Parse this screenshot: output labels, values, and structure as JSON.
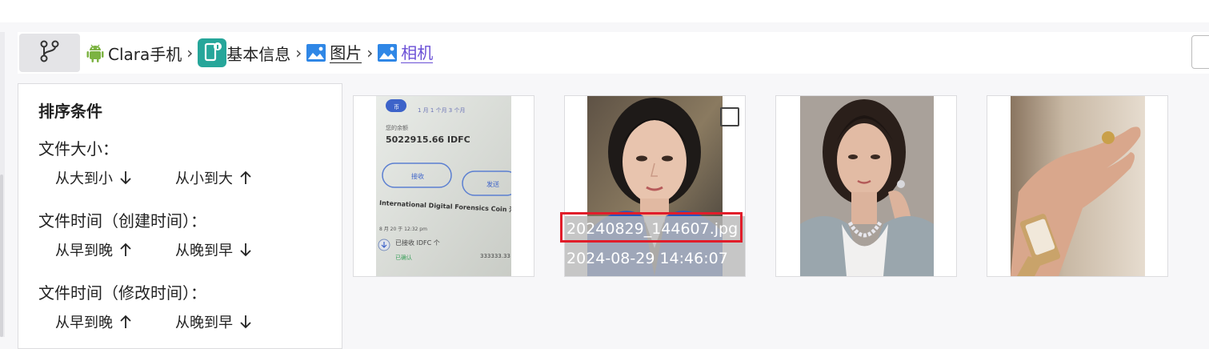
{
  "breadcrumb": {
    "items": [
      {
        "label": "Clara手机",
        "icon": "android-icon"
      },
      {
        "label": "基本信息",
        "icon": "phone-info-icon"
      },
      {
        "label": "图片",
        "icon": "image-icon"
      },
      {
        "label": "相机",
        "icon": "image-icon"
      }
    ],
    "separator": "›",
    "active_color": "#6a4fd6"
  },
  "sort": {
    "title": "排序条件",
    "file_size": {
      "label": "文件大小：",
      "options": [
        {
          "label": "从大到小",
          "direction": "down"
        },
        {
          "label": "从小到大",
          "direction": "up"
        }
      ]
    },
    "created_time": {
      "label": "文件时间（创建时间）：",
      "options": [
        {
          "label": "从早到晚",
          "direction": "up"
        },
        {
          "label": "从晚到早",
          "direction": "down"
        }
      ]
    },
    "modified_time": {
      "label": "文件时间（修改时间）：",
      "options": [
        {
          "label": "从早到晚",
          "direction": "up"
        },
        {
          "label": "从晚到早",
          "direction": "down"
        }
      ]
    }
  },
  "thumbnails": [
    {
      "subject": "phone screenshot of a wallet app",
      "screen_text": {
        "balance": "5022915.66 IDFC",
        "coin": "International Digital Forensics Coin 活动",
        "received": "已接收 IDFC 个",
        "confirmed": "已确认",
        "amount": "333333.33",
        "btn_receive": "接收",
        "btn_send": "发送"
      }
    },
    {
      "subject": "portrait of a woman",
      "filename": "20240829_144607.jpg",
      "datetime": "2024-08-29 14:46:07",
      "highlight_color": "#e11d2a"
    },
    {
      "subject": "portrait of a woman with necklace"
    },
    {
      "subject": "hand wearing a wristwatch"
    }
  ]
}
